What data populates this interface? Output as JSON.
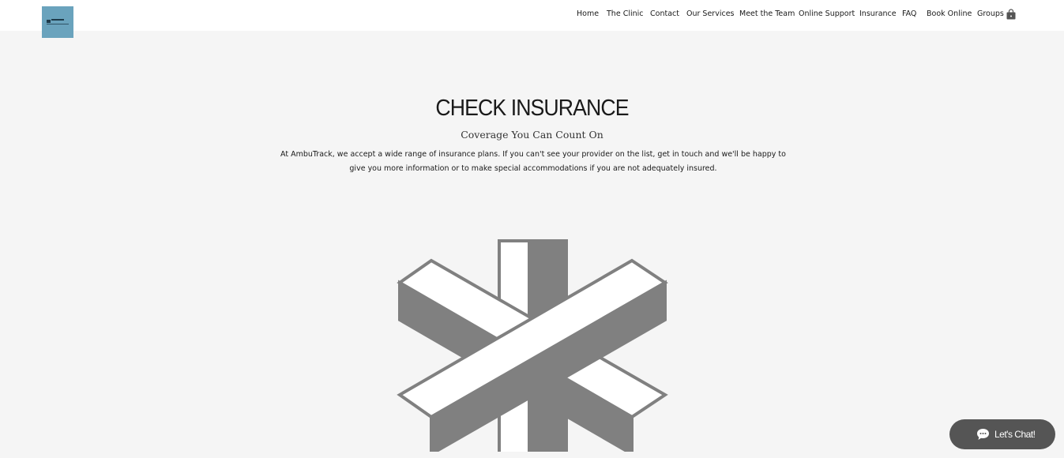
{
  "header": {
    "nav": [
      {
        "label": "Home"
      },
      {
        "label": "The Clinic"
      },
      {
        "label": "Contact"
      },
      {
        "label": "Our Services"
      },
      {
        "label": "Meet the Team"
      },
      {
        "label": "Online Support"
      },
      {
        "label": "Insurance"
      },
      {
        "label": "FAQ"
      },
      {
        "label": "Book Online"
      },
      {
        "label": "Groups"
      }
    ],
    "cart_icon": "shopping-bag-icon"
  },
  "main": {
    "title": "CHECK INSURANCE",
    "subtitle": "Coverage You Can Count On",
    "description": "At AmbuTrack, we accept a wide range of insurance plans. If you can't see your provider on the list, get in touch and we'll be happy to give you more information or to make special accommodations if you are not adequately insured."
  },
  "chat": {
    "label": "Let's Chat!",
    "icon": "chat-bubble-icon"
  },
  "colors": {
    "background": "#f5f5f5",
    "header": "#ffffff",
    "logo": "#6aa3bd",
    "star": "#808080",
    "chat_button": "#555555"
  }
}
